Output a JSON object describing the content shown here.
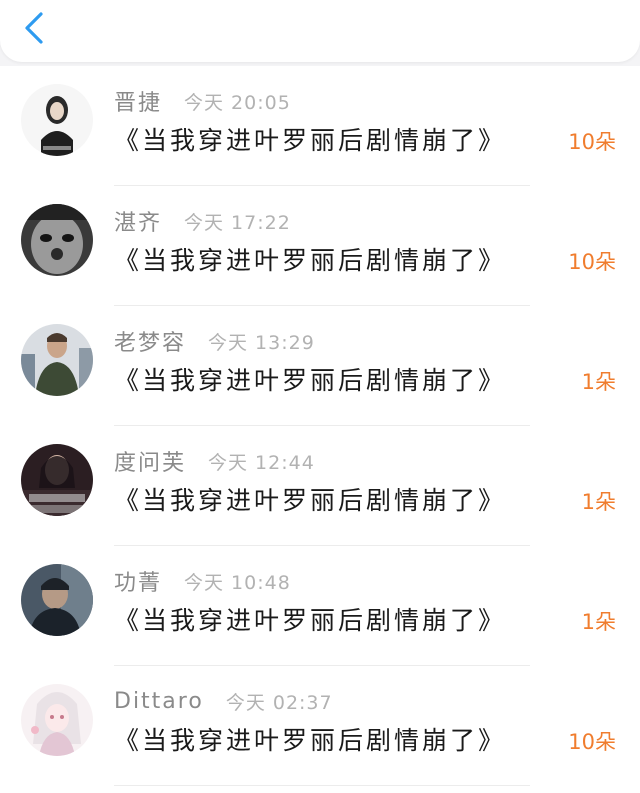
{
  "header": {
    "back_icon": "chevron-left-icon",
    "accent": "#2e9bf0"
  },
  "rows": [
    {
      "name": "晋捷",
      "time": "今天 20:05",
      "title": "《当我穿进叶罗丽后剧情崩了》",
      "count": "10朵"
    },
    {
      "name": "湛齐",
      "time": "今天 17:22",
      "title": "《当我穿进叶罗丽后剧情崩了》",
      "count": "10朵"
    },
    {
      "name": "老梦容",
      "time": "今天 13:29",
      "title": "《当我穿进叶罗丽后剧情崩了》",
      "count": "1朵"
    },
    {
      "name": "度问芙",
      "time": "今天 12:44",
      "title": "《当我穿进叶罗丽后剧情崩了》",
      "count": "1朵"
    },
    {
      "name": "功菁",
      "time": "今天 10:48",
      "title": "《当我穿进叶罗丽后剧情崩了》",
      "count": "1朵"
    },
    {
      "name": "Dittaro",
      "time": "今天 02:37",
      "title": "《当我穿进叶罗丽后剧情崩了》",
      "count": "10朵"
    }
  ],
  "colors": {
    "count": "#f07d2e",
    "name": "#8a8a8a",
    "time": "#b2b2b2",
    "title": "#1a1a1a"
  }
}
